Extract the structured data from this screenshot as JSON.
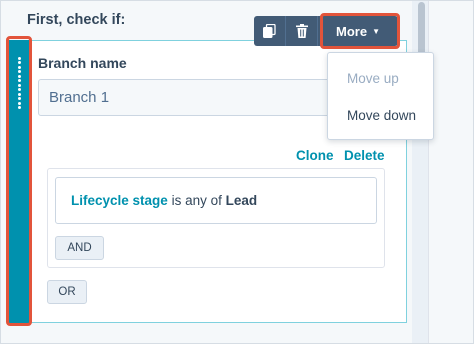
{
  "heading": "First, check if:",
  "branch": {
    "label": "Branch name",
    "name_value": "Branch 1"
  },
  "actions": {
    "clone": "Clone",
    "delete": "Delete"
  },
  "filter": {
    "property": "Lifecycle stage",
    "operator": "is any of",
    "value": "Lead"
  },
  "buttons": {
    "and": "AND",
    "or": "OR"
  },
  "toolbar": {
    "clone_icon": "copy-icon",
    "delete_icon": "trash-icon",
    "more_label": "More"
  },
  "menu": {
    "items": [
      {
        "label": "Move up",
        "disabled": true
      },
      {
        "label": "Move down",
        "disabled": false
      }
    ]
  },
  "colors": {
    "accent": "#0091ae",
    "highlight": "#e2543b",
    "toolbar": "#425b76"
  }
}
